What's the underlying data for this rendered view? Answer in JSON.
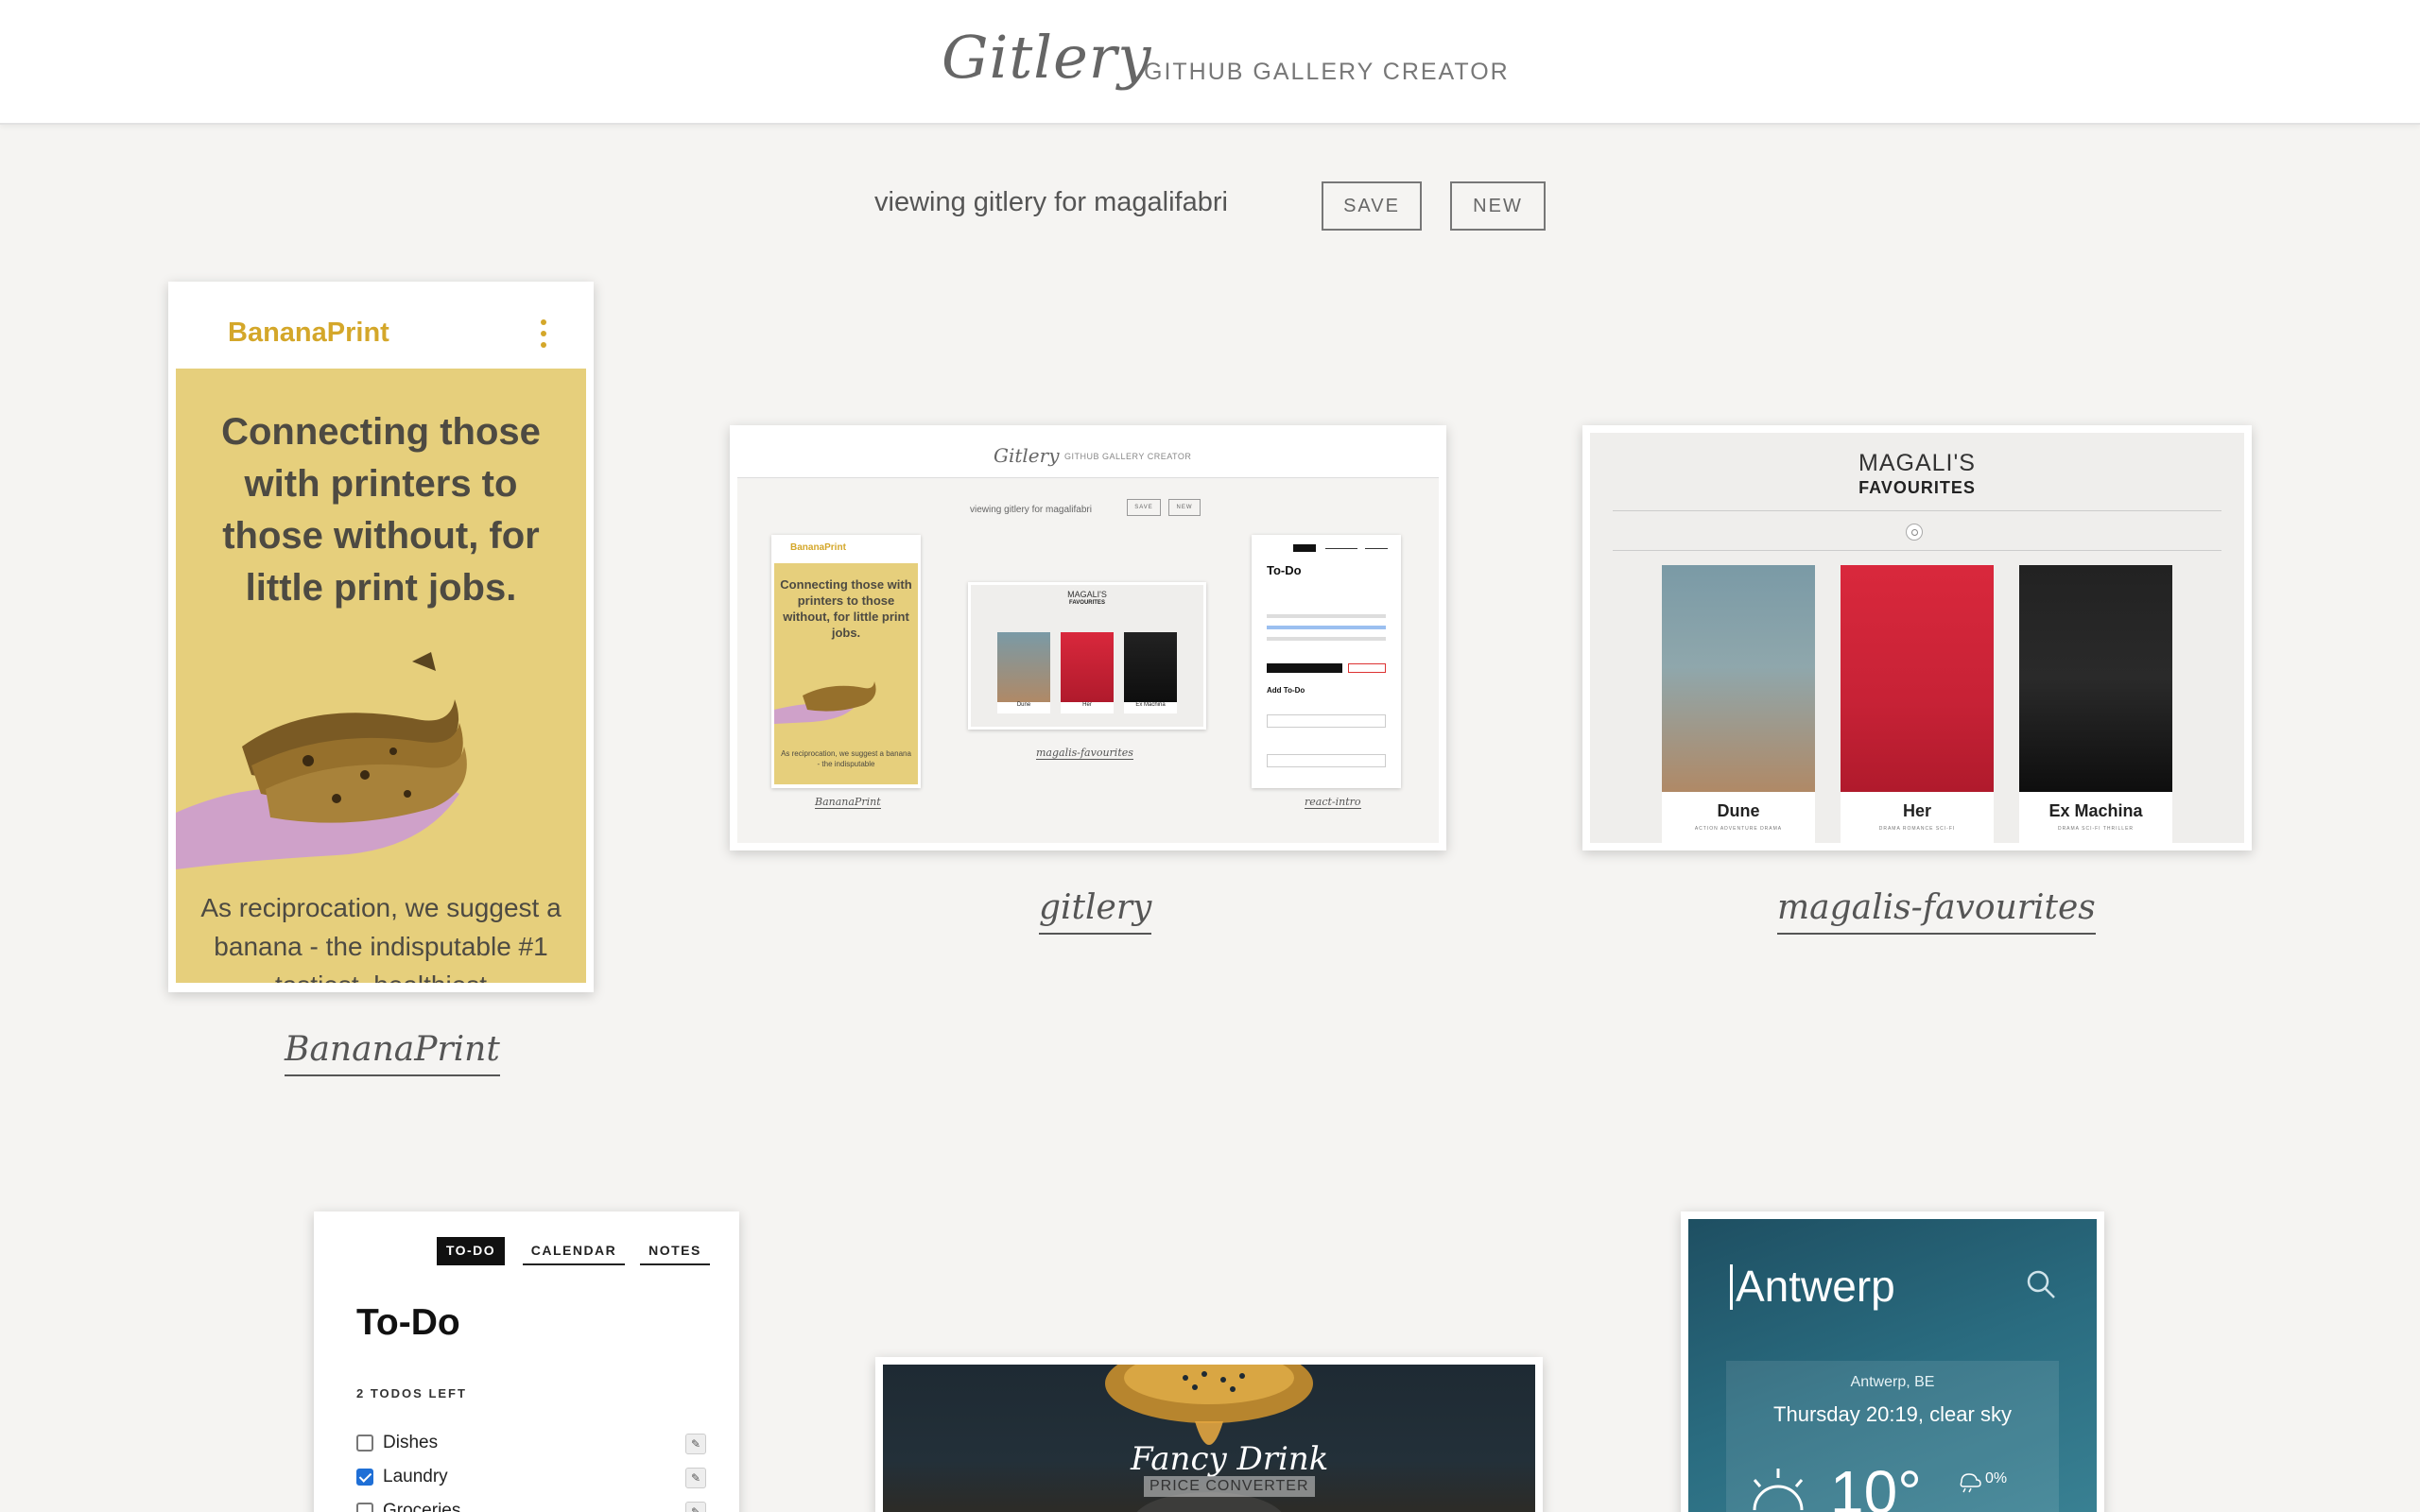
{
  "header": {
    "brand": "Gitlery",
    "tagline": "GITHUB GALLERY CREATOR"
  },
  "toolbar": {
    "viewing_text": "viewing gitlery for magalifabri",
    "save_label": "SAVE",
    "new_label": "NEW"
  },
  "gallery": {
    "bananaprint": {
      "caption": "BananaPrint",
      "app_name": "BananaPrint",
      "headline": "Connecting those with printers to those without, for little print jobs.",
      "body": "As reciprocation, we suggest a banana - the indisputable #1 tastiest, healthiest",
      "accent": "#d4a72a"
    },
    "gitlery": {
      "caption": "gitlery",
      "mini_brand": "Gitlery",
      "mini_tagline": "GITHUB GALLERY CREATOR",
      "mini_viewing": "viewing gitlery for magalifabri",
      "mini_save": "SAVE",
      "mini_new": "NEW",
      "mini_bp_name": "BananaPrint",
      "mini_bp_headline": "Connecting those with printers to those without, for little print jobs.",
      "mini_bp_body": "As reciprocation, we suggest a banana - the indisputable",
      "mini_mf_title1": "MAGALI'S",
      "mini_mf_title2": "FAVOURITES",
      "mini_mf_films": [
        "Dune",
        "Her",
        "Ex Machina"
      ],
      "mini_todo_title": "To-Do",
      "mini_todo_add": "Add To-Do",
      "mini_captions": [
        "BananaPrint",
        "magalis-favourites",
        "react-intro"
      ]
    },
    "favourites": {
      "caption": "magalis-favourites",
      "title_line1": "MAGALI'S",
      "title_line2": "FAVOURITES",
      "films": [
        {
          "title": "Dune",
          "genres": "ACTION   ADVENTURE   DRAMA",
          "color_top": "#7a9aa6",
          "color_bottom": "#b08966"
        },
        {
          "title": "Her",
          "genres": "DRAMA   ROMANCE   SCI-FI",
          "color_top": "#d9283c",
          "color_bottom": "#b01a2c"
        },
        {
          "title": "Ex Machina",
          "genres": "DRAMA   SCI-FI   THRILLER",
          "color_top": "#222222",
          "color_bottom": "#0e0e0e"
        }
      ]
    },
    "todo": {
      "tabs": [
        "TO-DO",
        "CALENDAR",
        "NOTES"
      ],
      "title": "To-Do",
      "count": "2 TODOS LEFT",
      "items": [
        {
          "label": "Dishes",
          "checked": false
        },
        {
          "label": "Laundry",
          "checked": true
        },
        {
          "label": "Groceries",
          "checked": false
        }
      ]
    },
    "fancydrink": {
      "title": "Fancy Drink",
      "subtitle": "PRICE CONVERTER"
    },
    "weather": {
      "city": "Antwerp",
      "location": "Antwerp, BE",
      "description": "Thursday 20:19, clear sky",
      "temperature": "10°",
      "precipitation": "0%"
    }
  }
}
